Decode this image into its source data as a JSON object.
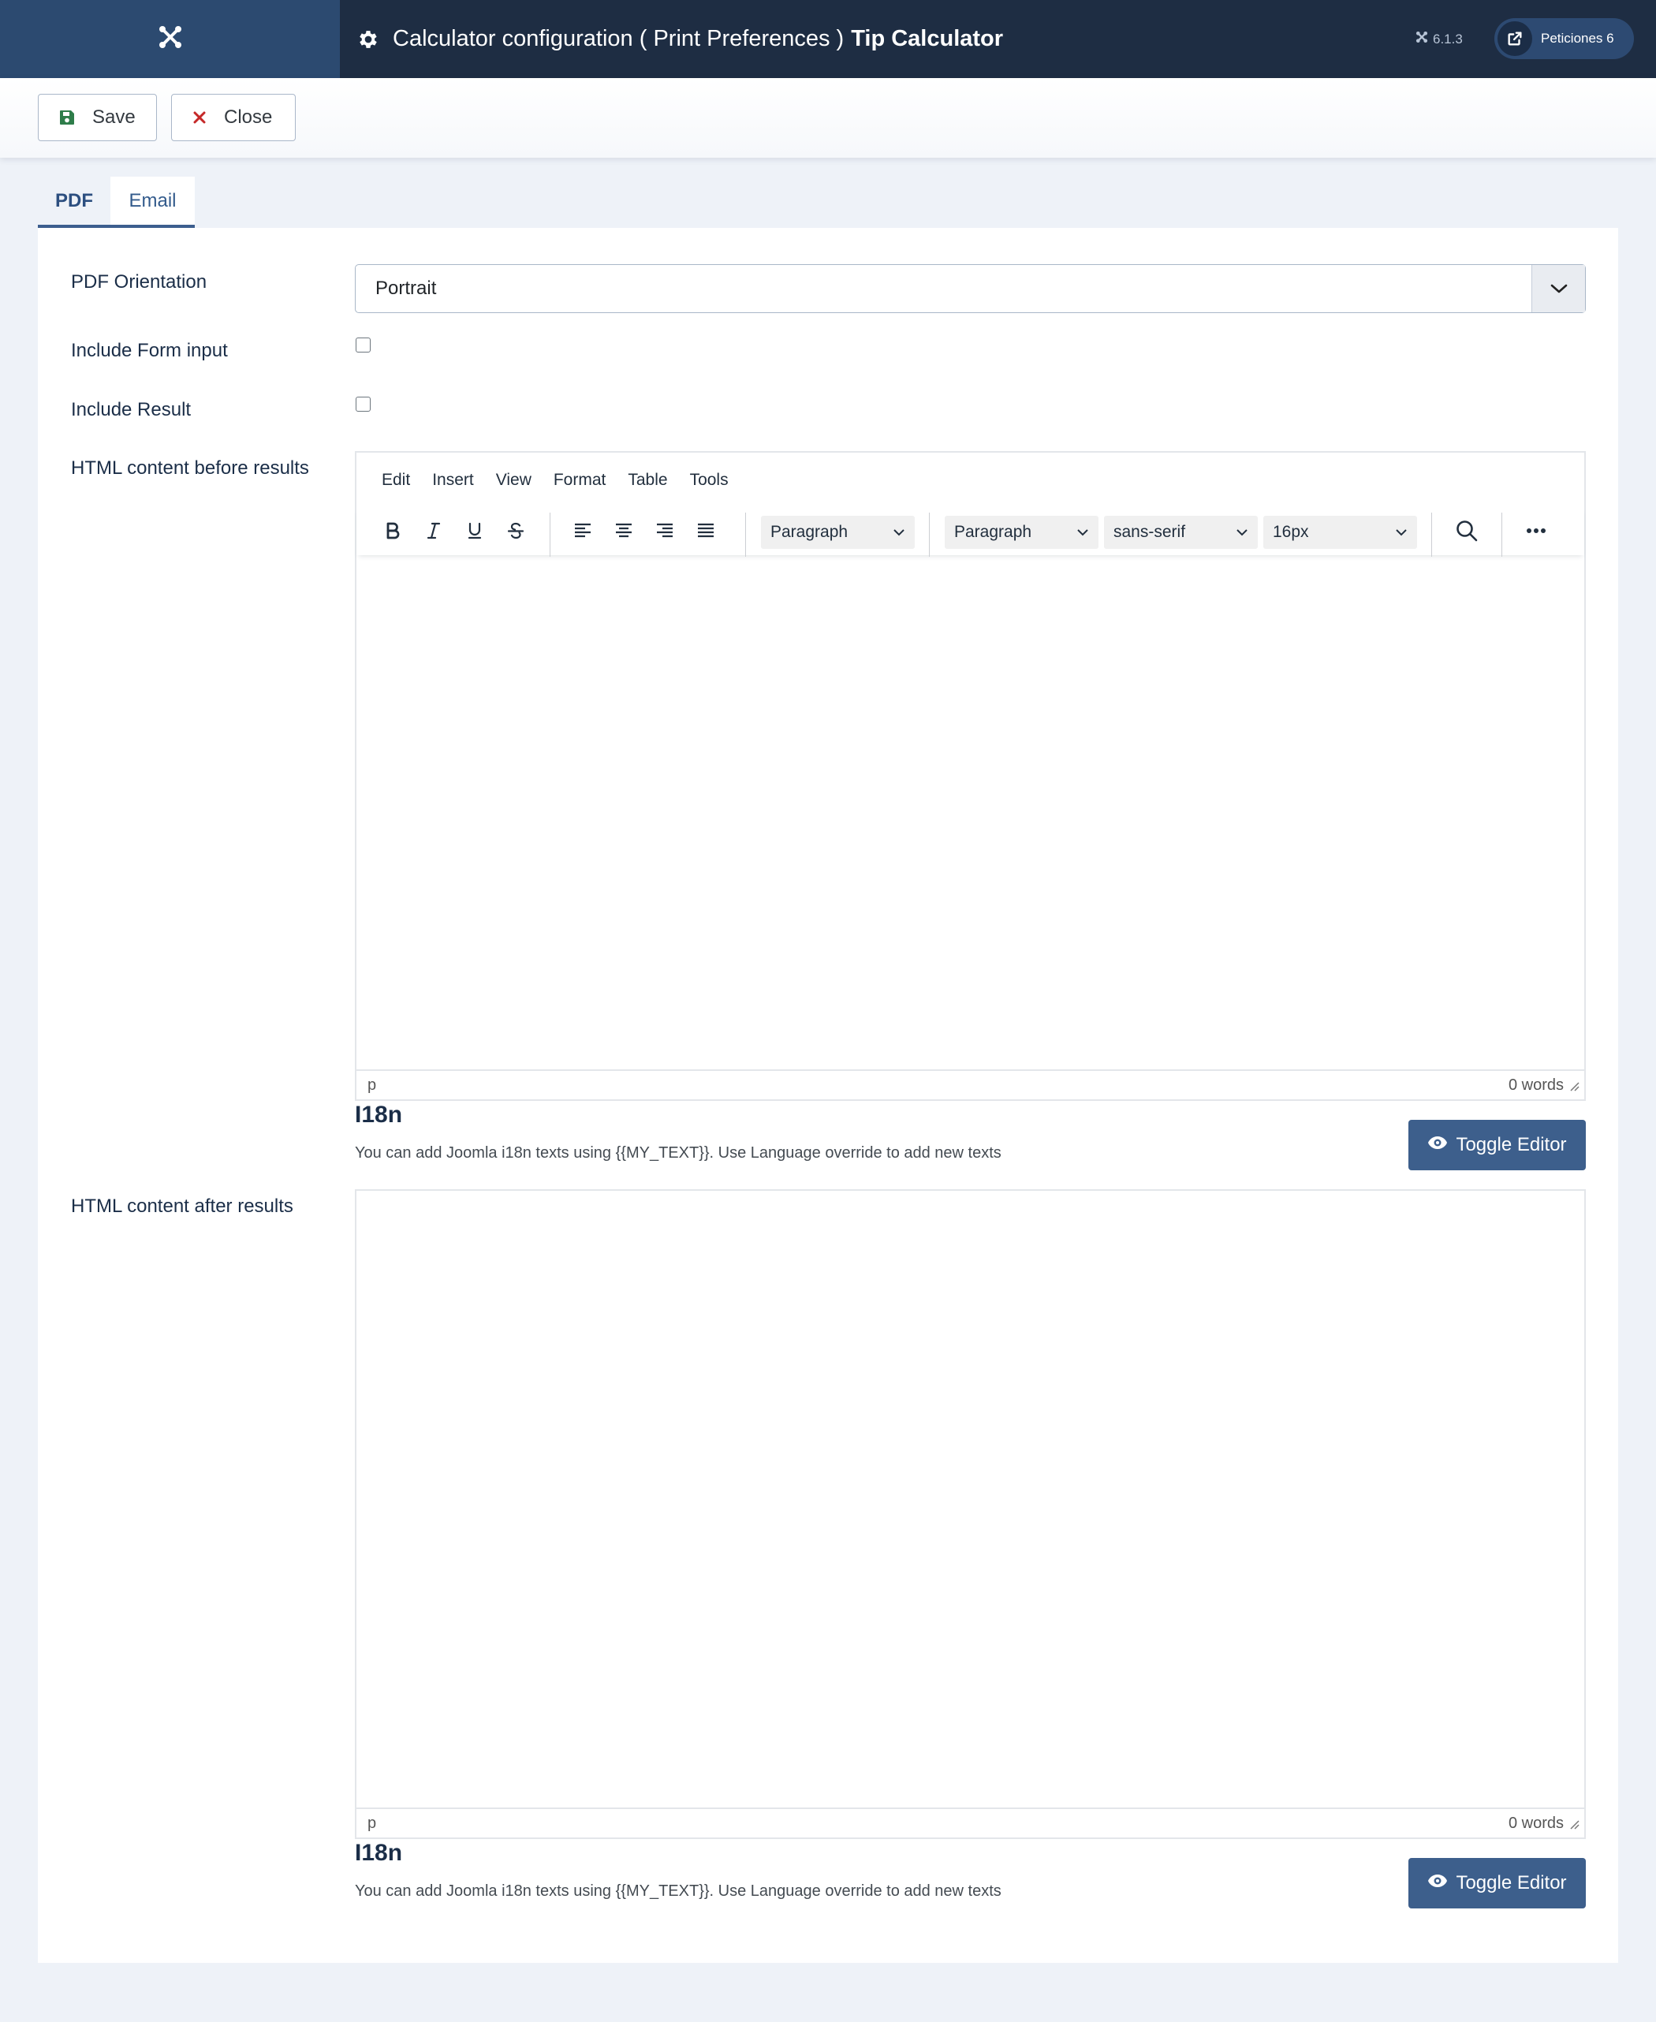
{
  "header": {
    "title_prefix": "Calculator configuration ( Print Preferences )",
    "title_strong": "Tip Calculator",
    "version": "6.1.3",
    "requests_label": "Peticiones 6",
    "logo_icon": "joomla-logo",
    "title_icon": "gear-icon"
  },
  "toolbar": {
    "save_label": "Save",
    "close_label": "Close",
    "save_icon": "floppy-disk-icon",
    "close_icon": "close-icon",
    "save_icon_color": "#2e7d4a",
    "close_icon_color": "#c52828"
  },
  "tabs": [
    {
      "label": "PDF",
      "active": true
    },
    {
      "label": "Email",
      "active": false
    }
  ],
  "form": {
    "orientation_label": "PDF Orientation",
    "orientation_value": "Portrait",
    "include_form_label": "Include Form input",
    "include_form_checked": false,
    "include_result_label": "Include Result",
    "include_result_checked": false,
    "html_before_label": "HTML content before results",
    "html_after_label": "HTML content after results"
  },
  "editor": {
    "menu": [
      "Edit",
      "Insert",
      "View",
      "Format",
      "Table",
      "Tools"
    ],
    "block_format": "Paragraph",
    "style_format": "Paragraph",
    "font_family": "sans-serif",
    "font_size": "16px",
    "status_path": "p",
    "word_count": "0 words"
  },
  "editor_after": {
    "status_path": "p",
    "word_count": "0 words"
  },
  "i18n": {
    "title": "I18n",
    "description": "You can add Joomla i18n texts using {{MY_TEXT}}. Use Language override to add new texts",
    "toggle_label": "Toggle Editor"
  },
  "colors": {
    "header_bg": "#1e2d43",
    "accent": "#3d5f8c",
    "page_bg": "#eef2f8"
  }
}
